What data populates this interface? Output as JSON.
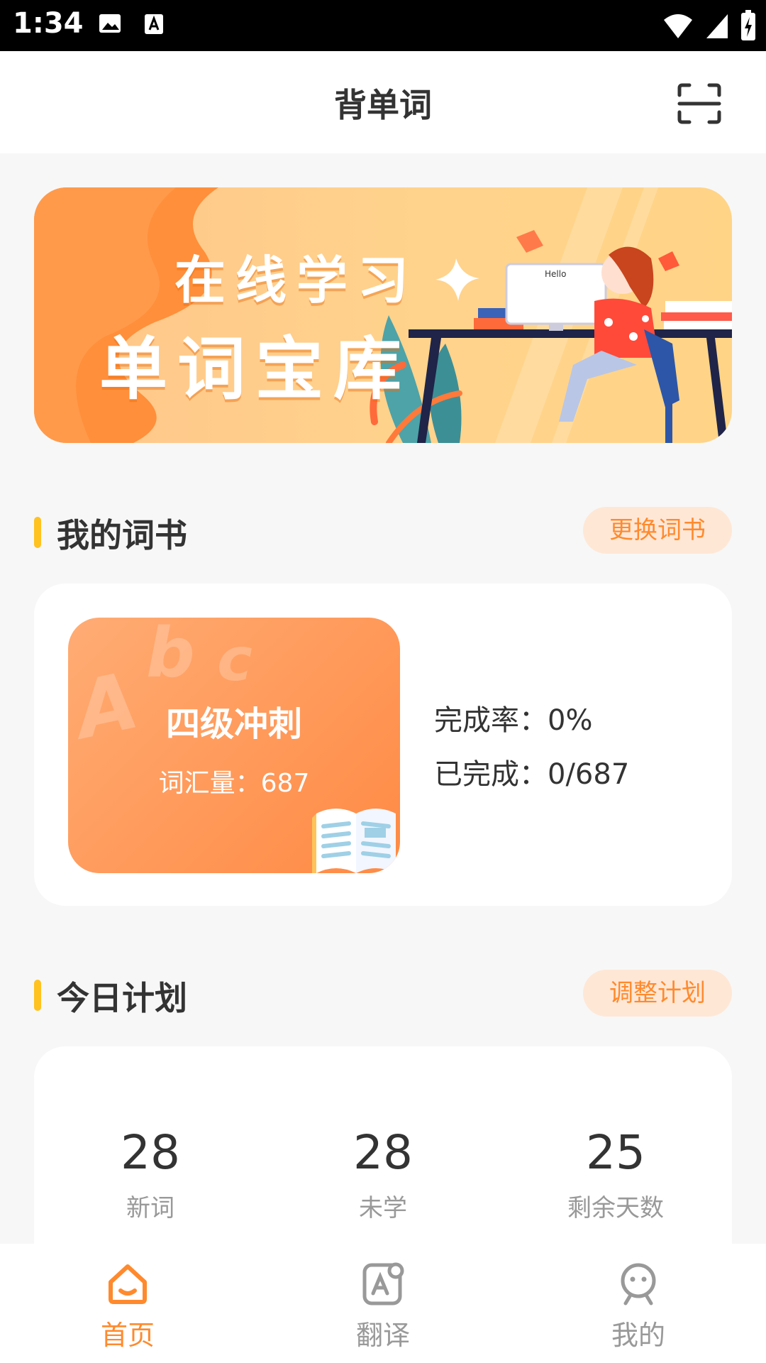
{
  "status_bar": {
    "time": "1:34"
  },
  "header": {
    "title": "背单词"
  },
  "banner": {
    "line1": "在线学习",
    "line2": "单词宝库",
    "screen_text": "Hello"
  },
  "my_book": {
    "section_title": "我的词书",
    "action_label": "更换词书",
    "book": {
      "title": "四级冲刺",
      "vocab_label": "词汇量：",
      "vocab_count": "687",
      "decor_letters": [
        "A",
        "b",
        "c"
      ]
    },
    "completion_label": "完成率：",
    "completion_value": "0%",
    "completed_label": "已完成：",
    "completed_value": "0/687"
  },
  "plan": {
    "section_title": "今日计划",
    "action_label": "调整计划",
    "stats": [
      {
        "value": "28",
        "label": "新词"
      },
      {
        "value": "28",
        "label": "未学"
      },
      {
        "value": "25",
        "label": "剩余天数"
      }
    ]
  },
  "bottom_nav": {
    "items": [
      {
        "label": "首页",
        "icon": "home-icon",
        "active": true
      },
      {
        "label": "翻译",
        "icon": "translate-icon",
        "active": false
      },
      {
        "label": "我的",
        "icon": "profile-icon",
        "active": false
      }
    ]
  },
  "colors": {
    "accent": "#ff8a2d",
    "marker": "#ffc21e",
    "pill_bg": "#ffe7d6",
    "inactive": "#999999"
  }
}
